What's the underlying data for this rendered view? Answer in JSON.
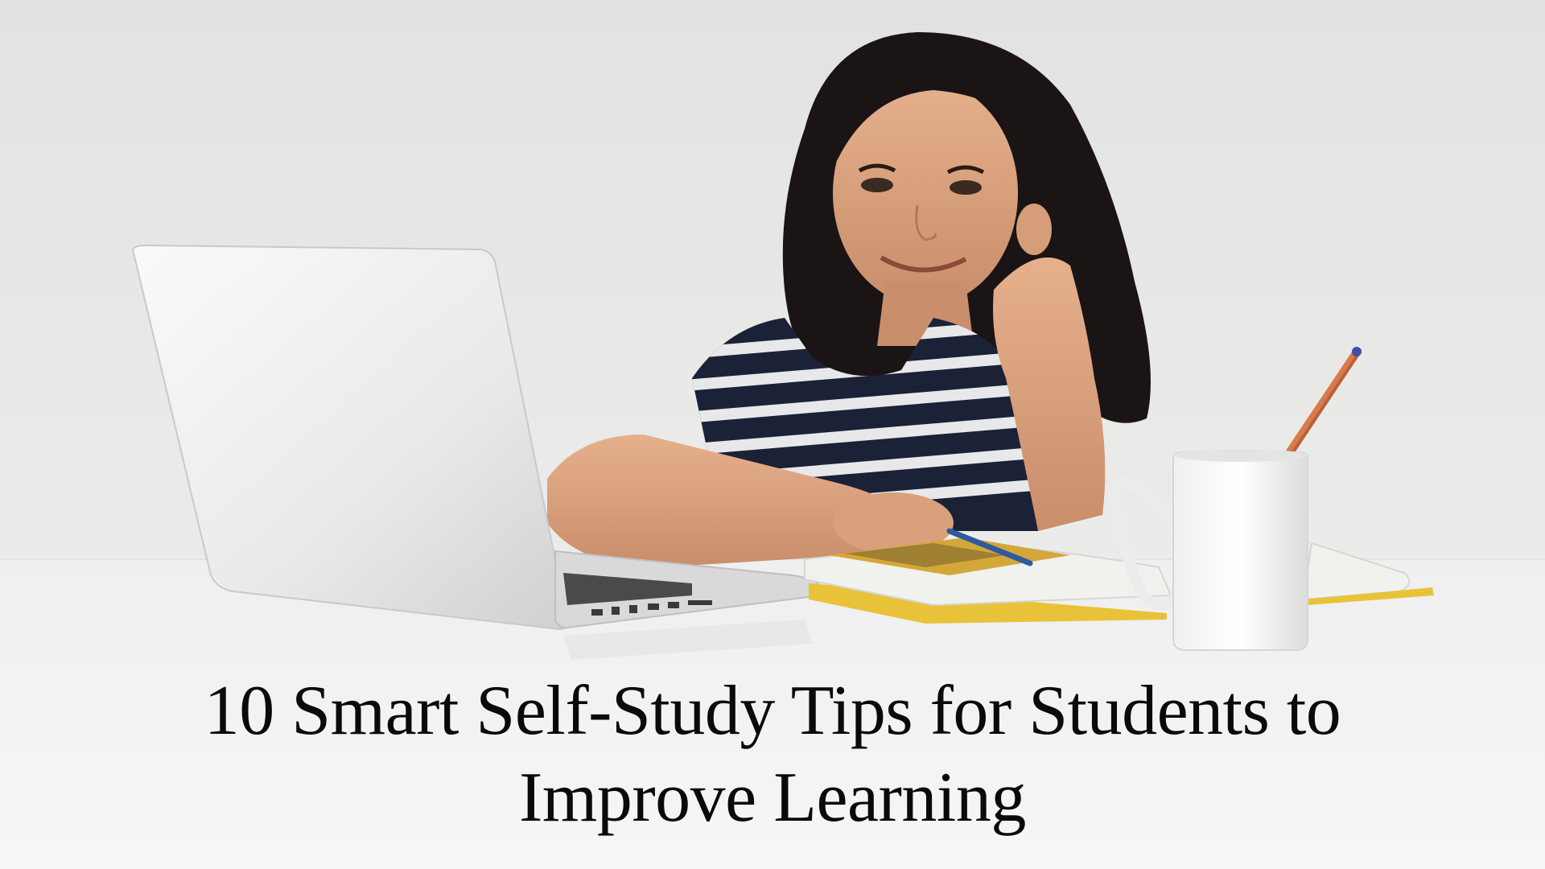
{
  "banner": {
    "title_line1": "10 Smart Self-Study Tips for Students to",
    "title_line2": "Improve Learning"
  },
  "scene": {
    "description_items": [
      "girl",
      "laptop",
      "open-book",
      "mug",
      "pencils"
    ]
  },
  "colors": {
    "background": "#e9e9e8",
    "table": "#f3f3f3",
    "text": "#0a0a0a",
    "shirt_navy": "#1b2136",
    "book_edge": "#e8c33a"
  }
}
